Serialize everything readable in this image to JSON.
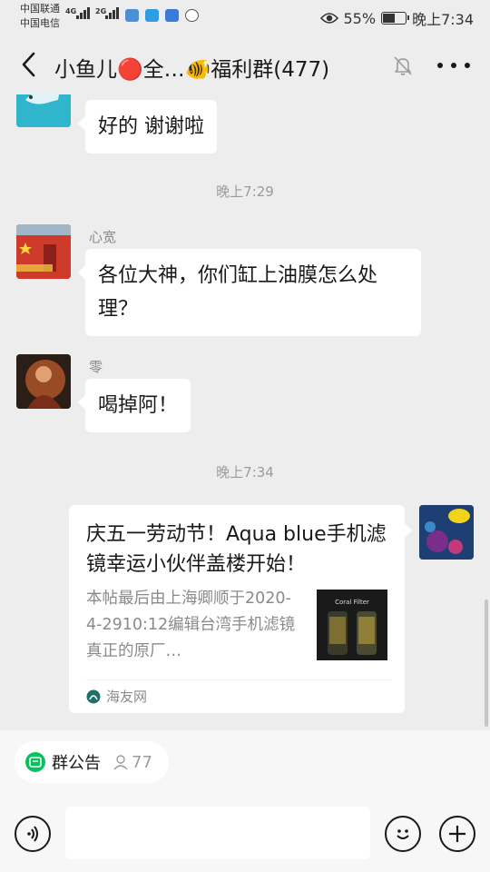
{
  "status_bar": {
    "carrier_1": "中国联通",
    "carrier_2": "中国电信",
    "net_1": "4G",
    "net_2": "2G",
    "battery_percent": "55%",
    "battery_level": 0.55,
    "time": "晚上7:34"
  },
  "header": {
    "title": "小鱼儿🔴全…🐠福利群(477)"
  },
  "messages": [
    {
      "type": "text",
      "sender": "",
      "text": "好的 谢谢啦"
    },
    {
      "type": "time",
      "text": "晚上7:29"
    },
    {
      "type": "text",
      "sender": "心宽",
      "text": "各位大神，你们缸上油膜怎么处理？"
    },
    {
      "type": "text",
      "sender": "零",
      "text": "喝掉阿！"
    },
    {
      "type": "time",
      "text": "晚上7:34"
    },
    {
      "type": "link_card",
      "title": "庆五一劳动节！Aqua blue手机滤镜幸运小伙伴盖楼开始！",
      "description": "本帖最后由上海卿顺于2020-4-2910:12编辑台湾手机滤镜真正的原厂…",
      "thumb_label": "Coral Filter",
      "source": "海友网"
    }
  ],
  "notice": {
    "label": "群公告",
    "count": "77"
  },
  "input": {
    "placeholder": ""
  },
  "colors": {
    "background": "#ededed",
    "bubble": "#ffffff",
    "accent": "#07c160"
  },
  "icons": [
    "back-icon",
    "mute-bell-icon",
    "more-icon",
    "voice-icon",
    "emoji-icon",
    "plus-icon",
    "notice-icon",
    "person-icon",
    "eye-icon",
    "battery-icon"
  ]
}
